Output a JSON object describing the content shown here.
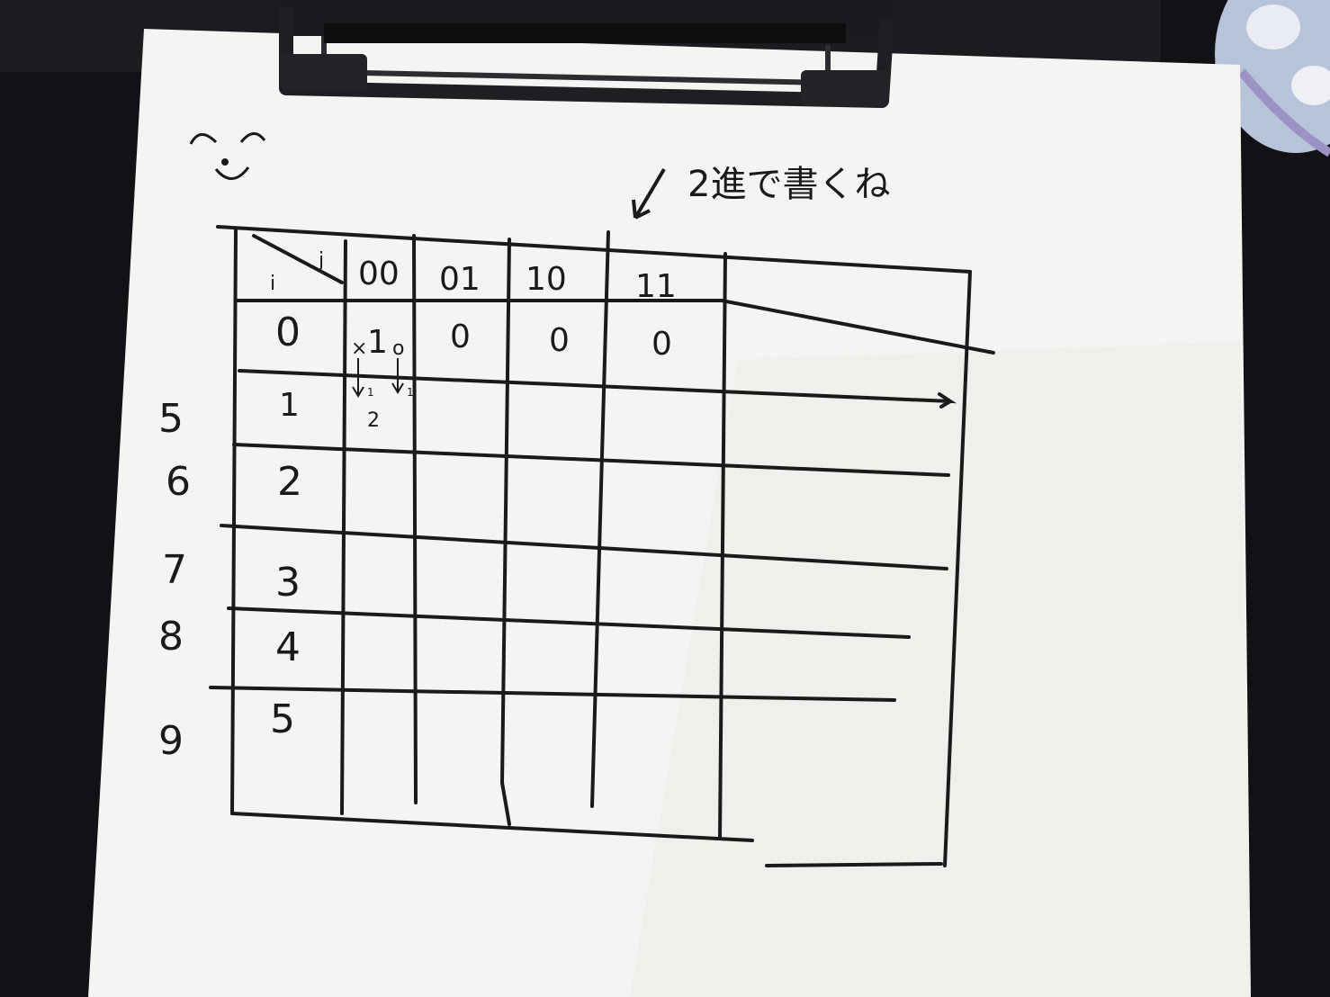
{
  "note": {
    "annotation": "2進で書くね",
    "smiley": "^_^"
  },
  "table": {
    "corner_col_label": "j",
    "corner_row_label": "i",
    "column_headers": [
      "00",
      "01",
      "10",
      "11",
      ""
    ],
    "row_headers": [
      "0",
      "1",
      "2",
      "3",
      "4",
      "5"
    ],
    "row0_values": [
      "1",
      "0",
      "0",
      "0"
    ],
    "cell_notes": {
      "x_mark": "×",
      "o_mark": "o",
      "sub_left": "1",
      "sub_right": "1",
      "sum": "2"
    }
  },
  "margin_numbers": [
    "5",
    "6",
    "7",
    "8",
    "9"
  ],
  "colors": {
    "paper": "#f4f4f2",
    "ink": "#1a1a1a",
    "background": "#121216",
    "clip": "#1e1e22"
  }
}
